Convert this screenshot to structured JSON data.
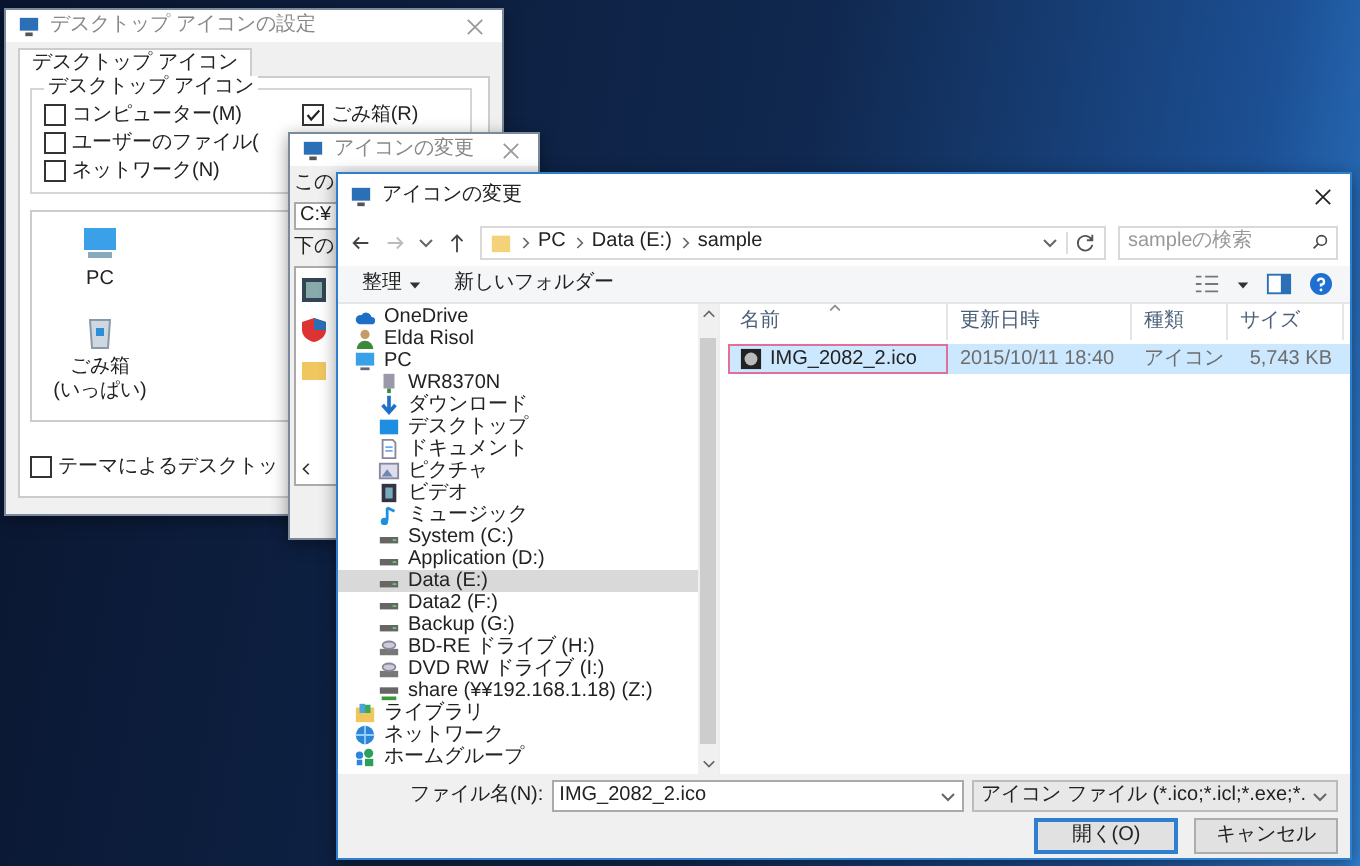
{
  "desktop_icons_window": {
    "title": "デスクトップ アイコンの設定",
    "tabs": [
      {
        "label": "デスクトップ アイコン",
        "selected": true
      }
    ],
    "group_label": "デスクトップ アイコン",
    "checkbox_columns": [
      [
        {
          "label": "コンピューター(M)",
          "checked": false
        },
        {
          "label": "ユーザーのファイル(",
          "checked": false
        },
        {
          "label": "ネットワーク(N)",
          "checked": false
        }
      ],
      [
        {
          "label": "ごみ箱(R)",
          "checked": true
        }
      ]
    ],
    "icons": [
      {
        "kind": "computer",
        "label": "PC"
      },
      {
        "kind": "bin",
        "label": "ごみ箱\n(いっぱい)"
      }
    ],
    "theme_checkbox": {
      "label": "テーマによるデスクトッ",
      "checked": false
    }
  },
  "change_icon_back_window": {
    "title": "アイコンの変更",
    "label_1": "この",
    "path": "C:¥",
    "label_2": "下の"
  },
  "change_icon_window": {
    "title": "アイコンの変更",
    "breadcrumb": [
      "PC",
      "Data (E:)",
      "sample"
    ],
    "search": {
      "placeholder": "sampleの検索"
    },
    "commands": [
      "整理",
      "新しいフォルダー"
    ],
    "tree": [
      {
        "label": "OneDrive",
        "kind": "cloud",
        "selected": false
      },
      {
        "label": "Elda Risol",
        "kind": "user",
        "selected": false
      },
      {
        "label": "PC",
        "kind": "computer",
        "selected": false,
        "children": [
          {
            "label": "WR8370N",
            "kind": "server",
            "selected": false
          },
          {
            "label": "ダウンロード",
            "kind": "download",
            "selected": false
          },
          {
            "label": "デスクトップ",
            "kind": "desktop",
            "selected": false
          },
          {
            "label": "ドキュメント",
            "kind": "document",
            "selected": false
          },
          {
            "label": "ピクチャ",
            "kind": "picture",
            "selected": false
          },
          {
            "label": "ビデオ",
            "kind": "video",
            "selected": false
          },
          {
            "label": "ミュージック",
            "kind": "music",
            "selected": false
          },
          {
            "label": "System (C:)",
            "kind": "drive",
            "selected": false
          },
          {
            "label": "Application (D:)",
            "kind": "drive",
            "selected": false
          },
          {
            "label": "Data (E:)",
            "kind": "drive",
            "selected": true
          },
          {
            "label": "Data2 (F:)",
            "kind": "drive",
            "selected": false
          },
          {
            "label": "Backup (G:)",
            "kind": "drive",
            "selected": false
          },
          {
            "label": "BD-RE ドライブ (H:)",
            "kind": "disc",
            "selected": false
          },
          {
            "label": "DVD RW ドライブ (I:)",
            "kind": "disc",
            "selected": false
          },
          {
            "label": "share (¥¥192.168.1.18) (Z:)",
            "kind": "netdrive",
            "selected": false
          }
        ]
      },
      {
        "label": "ライブラリ",
        "kind": "library",
        "selected": false
      },
      {
        "label": "ネットワーク",
        "kind": "network",
        "selected": false
      },
      {
        "label": "ホームグループ",
        "kind": "homegroup",
        "selected": false
      }
    ],
    "columns": [
      "名前",
      "更新日時",
      "種類",
      "サイズ"
    ],
    "files": [
      {
        "name": "IMG_2082_2.ico",
        "modified": "2015/10/11 18:40",
        "type": "アイコン",
        "size": "5,743 KB",
        "selected": true
      }
    ],
    "filename": {
      "label": "ファイル名(N):",
      "value": "IMG_2082_2.ico"
    },
    "filetype": "アイコン ファイル (*.ico;*.icl;*.exe;*.",
    "buttons": [
      {
        "label": "開く(O)",
        "default": true
      },
      {
        "label": "キャンセル",
        "default": false
      }
    ]
  }
}
